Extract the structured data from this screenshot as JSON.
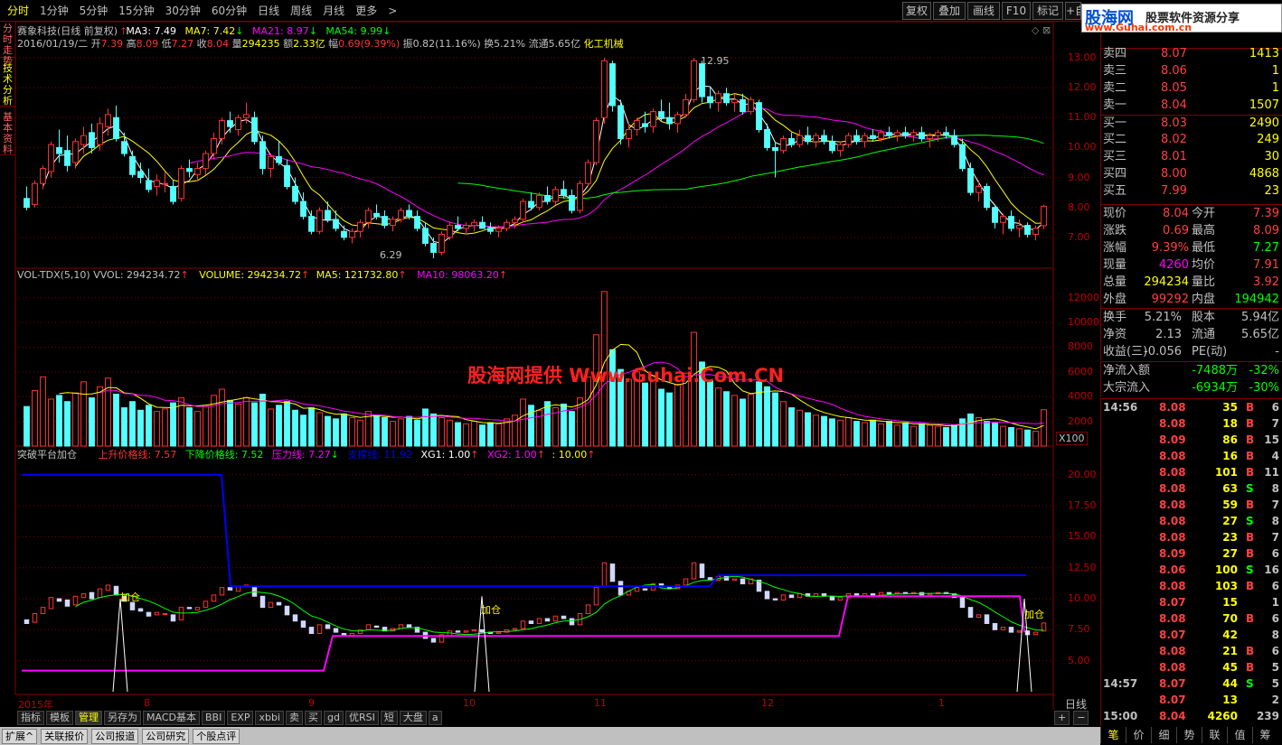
{
  "colors": {
    "up": "#ff3333",
    "down": "#54ffff",
    "ma3": "#ffffff",
    "ma7": "#ffff00",
    "ma21": "#ff00ff",
    "ma54": "#00ff00",
    "pressure": "#0000ff",
    "support": "#ff00ff",
    "accent": "#ffff00",
    "grid": "#800000"
  },
  "toolbar": {
    "periods": [
      "分时",
      "1分钟",
      "5分钟",
      "15分钟",
      "30分钟",
      "60分钟",
      "日线",
      "周线",
      "月线",
      "更多"
    ],
    "active_period": "分时",
    "more_chevron": ">",
    "right_buttons": [
      "复权",
      "叠加",
      "画线",
      "F10",
      "标记",
      "+自"
    ]
  },
  "left_tabs": [
    "分时走势",
    "技术分析",
    "基本资料"
  ],
  "brand": {
    "logo": "股海网",
    "subtitle": "股票软件资源分享",
    "url": "www.Guhai.com.cn"
  },
  "watermark": "股海网提供 Www.Guhai.Com.CN",
  "main_pane": {
    "title": "赛象科技(日线 前复权)",
    "ma3_label": "MA3: 7.49",
    "ma7_label": "MA7: 7.42",
    "ma21_label": "MA21: 8.97",
    "ma54_label": "MA54: 9.99",
    "bar_info": {
      "date": "2016/01/19/二",
      "open_label": "开",
      "open": "7.39",
      "high_label": "高",
      "high": "8.09",
      "low_label": "低",
      "low": "7.27",
      "close_label": "收",
      "close": "8.04",
      "vol_label": "量",
      "vol": "294235",
      "amt_label": "额",
      "amt": "2.33亿",
      "chg_label": "幅",
      "chg": "0.69(9.39%)",
      "amp": "振0.82(11.16%)",
      "turn": "换5.21%",
      "float": "流通5.65亿",
      "sector": "化工机械"
    },
    "high_tag": "12.95",
    "low_tag": "6.29",
    "axis": [
      "13.00",
      "12.00",
      "11.00",
      "10.00",
      "9.00",
      "8.00",
      "7.00"
    ]
  },
  "vol_pane": {
    "title": "VOL-TDX(5,10)",
    "vvol": "VVOL: 294234.72",
    "volume": "VOLUME: 294234.72",
    "ma5": "MA5: 121732.80",
    "ma10": "MA10: 98063.20",
    "axis": [
      "12000",
      "10000",
      "8000",
      "6000",
      "4000",
      "2000"
    ],
    "unit": "X100"
  },
  "ind_pane": {
    "title": "突破平台加仓",
    "up": "上升价格线: 7.57",
    "down": "下降价格线: 7.52",
    "press": "压力线: 7.27",
    "support": "支撑线: 11.92",
    "xg1": "XG1: 1.00",
    "xg2": "XG2: 1.00",
    "ten": ": 10.00",
    "signal": "加仓",
    "axis": [
      "20.00",
      "17.50",
      "15.00",
      "12.50",
      "10.00",
      "7.50",
      "5.00"
    ]
  },
  "x_axis": {
    "labels": [
      "2015年",
      "8",
      "9",
      "10",
      "11",
      "12",
      "1"
    ],
    "period": "日线"
  },
  "bottom_tabs": [
    "指标",
    "模板",
    "管理",
    "另存为",
    "MACD基本",
    "BBI",
    "EXP",
    "xbbi",
    "卖",
    "买",
    "gd",
    "优RSI",
    "短",
    "大盘",
    "a"
  ],
  "bottom_active": "管理",
  "bottom_controls": [
    "+",
    "−",
    "◀",
    "▶"
  ],
  "status_tabs": [
    "扩展^",
    "关联报价",
    "公司报道",
    "公司研究",
    "个股点评"
  ],
  "order_book": {
    "asks": [
      {
        "label": "卖四",
        "price": "8.07",
        "vol": "1413"
      },
      {
        "label": "卖三",
        "price": "8.06",
        "vol": "1"
      },
      {
        "label": "卖二",
        "price": "8.05",
        "vol": "1"
      },
      {
        "label": "卖一",
        "price": "8.04",
        "vol": "1507"
      }
    ],
    "bids": [
      {
        "label": "买一",
        "price": "8.03",
        "vol": "2490"
      },
      {
        "label": "买二",
        "price": "8.02",
        "vol": "249"
      },
      {
        "label": "买三",
        "price": "8.01",
        "vol": "30"
      },
      {
        "label": "买四",
        "price": "8.00",
        "vol": "4868"
      },
      {
        "label": "买五",
        "price": "7.99",
        "vol": "23"
      }
    ]
  },
  "quote": [
    {
      "l1": "现价",
      "v1": "8.04",
      "c1": "#ff4040",
      "l2": "今开",
      "v2": "7.39",
      "c2": "#ff4040"
    },
    {
      "l1": "涨跌",
      "v1": "0.69",
      "c1": "#ff4040",
      "l2": "最高",
      "v2": "8.09",
      "c2": "#ff4040"
    },
    {
      "l1": "涨幅",
      "v1": "9.39%",
      "c1": "#ff4040",
      "l2": "最低",
      "v2": "7.27",
      "c2": "#00ff00"
    },
    {
      "l1": "现量",
      "v1": "4260",
      "c1": "#ff00ff",
      "l2": "均价",
      "v2": "7.91",
      "c2": "#ff4040"
    },
    {
      "l1": "总量",
      "v1": "294234",
      "c1": "#ffff00",
      "l2": "量比",
      "v2": "3.92",
      "c2": "#ff4040"
    },
    {
      "l1": "外盘",
      "v1": "99292",
      "c1": "#ff4040",
      "l2": "内盘",
      "v2": "194942",
      "c2": "#00ff00"
    }
  ],
  "fund": [
    {
      "l1": "换手",
      "v1": "5.21%",
      "l2": "股本",
      "v2": "5.94亿"
    },
    {
      "l1": "净资",
      "v1": "2.13",
      "l2": "流通",
      "v2": "5.65亿"
    },
    {
      "l1": "收益(三)",
      "v1": "-0.056",
      "l2": "PE(动)",
      "v2": "-"
    }
  ],
  "flow": [
    {
      "label": "净流入额",
      "amount": "-7488万",
      "pct": "-32%"
    },
    {
      "label": "大宗流入",
      "amount": "-6934万",
      "pct": "-30%"
    }
  ],
  "ticks": [
    {
      "t": "14:56",
      "p": "8.08",
      "v": "35",
      "s": "B",
      "n": "6"
    },
    {
      "t": "",
      "p": "8.08",
      "v": "18",
      "s": "B",
      "n": "7"
    },
    {
      "t": "",
      "p": "8.09",
      "v": "86",
      "s": "B",
      "n": "15"
    },
    {
      "t": "",
      "p": "8.08",
      "v": "16",
      "s": "B",
      "n": "4"
    },
    {
      "t": "",
      "p": "8.08",
      "v": "101",
      "s": "B",
      "n": "11"
    },
    {
      "t": "",
      "p": "8.08",
      "v": "63",
      "s": "S",
      "n": "8"
    },
    {
      "t": "",
      "p": "8.08",
      "v": "59",
      "s": "B",
      "n": "7"
    },
    {
      "t": "",
      "p": "8.08",
      "v": "27",
      "s": "S",
      "n": "8"
    },
    {
      "t": "",
      "p": "8.08",
      "v": "23",
      "s": "B",
      "n": "7"
    },
    {
      "t": "",
      "p": "8.09",
      "v": "27",
      "s": "B",
      "n": "6"
    },
    {
      "t": "",
      "p": "8.06",
      "v": "100",
      "s": "S",
      "n": "16"
    },
    {
      "t": "",
      "p": "8.08",
      "v": "103",
      "s": "B",
      "n": "6"
    },
    {
      "t": "",
      "p": "8.07",
      "v": "15",
      "s": "",
      "n": "1"
    },
    {
      "t": "",
      "p": "8.08",
      "v": "70",
      "s": "B",
      "n": "6"
    },
    {
      "t": "",
      "p": "8.07",
      "v": "42",
      "s": "",
      "n": "8"
    },
    {
      "t": "",
      "p": "8.08",
      "v": "21",
      "s": "B",
      "n": "6"
    },
    {
      "t": "",
      "p": "8.08",
      "v": "45",
      "s": "B",
      "n": "5"
    },
    {
      "t": "14:57",
      "p": "8.07",
      "v": "44",
      "s": "S",
      "n": "5"
    },
    {
      "t": "",
      "p": "8.07",
      "v": "13",
      "s": "",
      "n": "2"
    },
    {
      "t": "15:00",
      "p": "8.04",
      "v": "4260",
      "s": "",
      "n": "239"
    }
  ],
  "right_bottom_tabs": [
    "笔",
    "价",
    "细",
    "势",
    "联",
    "值",
    "筹"
  ],
  "chart_data": [
    {
      "type": "candlestick",
      "title": "赛象科技(日线 前复权)",
      "ylim": [
        6.0,
        13.3
      ],
      "candles": [
        [
          8.3,
          8.7,
          7.9,
          8.0
        ],
        [
          8.1,
          8.9,
          8.0,
          8.8
        ],
        [
          8.8,
          9.4,
          8.6,
          9.3
        ],
        [
          9.2,
          10.2,
          9.0,
          10.1
        ],
        [
          10.0,
          10.6,
          9.5,
          9.8
        ],
        [
          9.9,
          10.4,
          9.2,
          9.4
        ],
        [
          9.5,
          10.3,
          9.3,
          10.2
        ],
        [
          10.1,
          10.7,
          9.8,
          10.4
        ],
        [
          10.5,
          10.8,
          9.8,
          10.0
        ],
        [
          10.1,
          11.0,
          9.9,
          10.8
        ],
        [
          10.7,
          11.3,
          10.4,
          11.1
        ],
        [
          11.0,
          11.4,
          10.2,
          10.3
        ],
        [
          10.2,
          10.5,
          9.7,
          9.8
        ],
        [
          9.7,
          9.9,
          9.0,
          9.1
        ],
        [
          9.2,
          9.5,
          8.8,
          9.0
        ],
        [
          8.9,
          9.3,
          8.5,
          8.6
        ],
        [
          8.7,
          9.1,
          8.4,
          8.9
        ],
        [
          8.8,
          9.2,
          8.5,
          8.8
        ],
        [
          8.7,
          8.9,
          8.1,
          8.2
        ],
        [
          8.3,
          9.4,
          8.2,
          9.3
        ],
        [
          9.3,
          9.6,
          9.0,
          9.2
        ],
        [
          9.1,
          9.5,
          8.9,
          9.3
        ],
        [
          9.3,
          9.9,
          9.1,
          9.8
        ],
        [
          9.8,
          10.5,
          9.6,
          10.3
        ],
        [
          10.3,
          11.0,
          10.1,
          10.9
        ],
        [
          10.9,
          11.2,
          10.5,
          10.7
        ],
        [
          10.6,
          11.1,
          10.4,
          11.0
        ],
        [
          11.0,
          11.5,
          10.8,
          11.1
        ],
        [
          11.0,
          11.2,
          10.1,
          10.2
        ],
        [
          10.2,
          10.4,
          9.1,
          9.3
        ],
        [
          9.3,
          9.8,
          9.0,
          9.7
        ],
        [
          9.7,
          10.2,
          9.4,
          9.5
        ],
        [
          9.4,
          9.6,
          8.6,
          8.7
        ],
        [
          8.7,
          9.0,
          8.1,
          8.2
        ],
        [
          8.2,
          8.5,
          7.6,
          7.7
        ],
        [
          7.7,
          7.9,
          7.1,
          7.2
        ],
        [
          7.2,
          8.0,
          7.1,
          7.9
        ],
        [
          7.9,
          8.2,
          7.5,
          7.6
        ],
        [
          7.6,
          7.9,
          7.2,
          7.3
        ],
        [
          7.2,
          7.4,
          6.9,
          7.0
        ],
        [
          7.0,
          7.3,
          6.8,
          7.2
        ],
        [
          7.2,
          7.6,
          7.0,
          7.5
        ],
        [
          7.5,
          8.0,
          7.3,
          7.9
        ],
        [
          7.8,
          8.1,
          7.6,
          7.7
        ],
        [
          7.7,
          7.9,
          7.3,
          7.4
        ],
        [
          7.4,
          7.7,
          7.2,
          7.6
        ],
        [
          7.6,
          8.0,
          7.5,
          7.9
        ],
        [
          7.9,
          8.1,
          7.6,
          7.7
        ],
        [
          7.7,
          7.9,
          7.2,
          7.3
        ],
        [
          7.3,
          7.5,
          6.7,
          6.8
        ],
        [
          6.8,
          7.0,
          6.3,
          6.5
        ],
        [
          6.5,
          7.2,
          6.4,
          7.1
        ],
        [
          7.0,
          7.5,
          6.9,
          7.4
        ],
        [
          7.4,
          7.7,
          7.2,
          7.3
        ],
        [
          7.3,
          7.5,
          7.1,
          7.4
        ],
        [
          7.4,
          7.6,
          7.2,
          7.5
        ],
        [
          7.5,
          7.7,
          7.3,
          7.3
        ],
        [
          7.3,
          7.5,
          7.1,
          7.2
        ],
        [
          7.2,
          7.4,
          7.0,
          7.3
        ],
        [
          7.3,
          7.6,
          7.2,
          7.5
        ],
        [
          7.5,
          7.7,
          7.3,
          7.6
        ],
        [
          7.6,
          8.3,
          7.5,
          8.2
        ],
        [
          8.2,
          8.5,
          7.9,
          8.0
        ],
        [
          8.0,
          8.5,
          7.9,
          8.4
        ],
        [
          8.4,
          8.7,
          8.1,
          8.2
        ],
        [
          8.2,
          8.7,
          8.1,
          8.6
        ],
        [
          8.6,
          8.9,
          8.3,
          8.4
        ],
        [
          8.4,
          8.6,
          7.8,
          7.9
        ],
        [
          7.9,
          8.9,
          7.8,
          8.8
        ],
        [
          8.8,
          9.6,
          8.7,
          9.5
        ],
        [
          9.5,
          11.0,
          9.4,
          10.9
        ],
        [
          11.0,
          13.0,
          10.8,
          12.9
        ],
        [
          12.8,
          12.9,
          11.2,
          11.4
        ],
        [
          11.4,
          11.6,
          10.1,
          10.3
        ],
        [
          10.3,
          10.8,
          10.0,
          10.6
        ],
        [
          10.6,
          11.0,
          10.4,
          10.9
        ],
        [
          10.8,
          11.2,
          10.5,
          10.7
        ],
        [
          10.7,
          11.3,
          10.5,
          11.2
        ],
        [
          11.2,
          11.6,
          10.9,
          11.0
        ],
        [
          11.0,
          11.5,
          10.6,
          10.8
        ],
        [
          10.8,
          11.2,
          10.5,
          11.1
        ],
        [
          11.1,
          11.8,
          11.0,
          11.6
        ],
        [
          11.6,
          13.0,
          11.5,
          12.9
        ],
        [
          12.8,
          12.9,
          11.5,
          11.7
        ],
        [
          11.7,
          12.0,
          11.3,
          11.5
        ],
        [
          11.5,
          11.9,
          11.2,
          11.8
        ],
        [
          11.8,
          12.0,
          11.4,
          11.5
        ],
        [
          11.5,
          11.8,
          11.2,
          11.6
        ],
        [
          11.6,
          11.8,
          11.1,
          11.2
        ],
        [
          11.2,
          11.7,
          11.1,
          11.6
        ],
        [
          11.5,
          11.6,
          10.5,
          10.6
        ],
        [
          10.6,
          10.8,
          9.9,
          10.0
        ],
        [
          10.0,
          10.2,
          9.0,
          9.9
        ],
        [
          9.9,
          10.4,
          9.8,
          10.3
        ],
        [
          10.3,
          10.5,
          10.0,
          10.1
        ],
        [
          10.1,
          10.6,
          10.0,
          10.4
        ],
        [
          10.4,
          10.7,
          10.1,
          10.2
        ],
        [
          10.2,
          10.5,
          10.0,
          10.4
        ],
        [
          10.4,
          10.6,
          10.1,
          10.2
        ],
        [
          10.2,
          10.4,
          9.8,
          9.9
        ],
        [
          9.9,
          10.2,
          9.7,
          10.1
        ],
        [
          10.1,
          10.5,
          10.0,
          10.4
        ],
        [
          10.4,
          10.6,
          10.1,
          10.2
        ],
        [
          10.2,
          10.5,
          10.0,
          10.4
        ],
        [
          10.4,
          10.6,
          10.2,
          10.3
        ],
        [
          10.3,
          10.6,
          10.2,
          10.5
        ],
        [
          10.5,
          10.7,
          10.3,
          10.4
        ],
        [
          10.4,
          10.6,
          10.2,
          10.5
        ],
        [
          10.5,
          10.7,
          10.3,
          10.4
        ],
        [
          10.4,
          10.6,
          10.2,
          10.5
        ],
        [
          10.5,
          10.7,
          10.2,
          10.3
        ],
        [
          10.3,
          10.5,
          10.0,
          10.4
        ],
        [
          10.4,
          10.6,
          10.2,
          10.5
        ],
        [
          10.5,
          10.7,
          10.3,
          10.4
        ],
        [
          10.4,
          10.6,
          10.0,
          10.1
        ],
        [
          10.1,
          10.3,
          9.2,
          9.3
        ],
        [
          9.3,
          9.5,
          8.4,
          8.5
        ],
        [
          8.5,
          8.9,
          8.2,
          8.7
        ],
        [
          8.7,
          8.8,
          7.9,
          8.0
        ],
        [
          8.0,
          8.1,
          7.3,
          7.5
        ],
        [
          7.5,
          7.8,
          7.1,
          7.7
        ],
        [
          7.7,
          7.9,
          7.2,
          7.3
        ],
        [
          7.3,
          7.6,
          7.0,
          7.4
        ],
        [
          7.4,
          7.5,
          7.0,
          7.1
        ],
        [
          7.1,
          7.4,
          6.9,
          7.3
        ],
        [
          7.39,
          8.09,
          7.27,
          8.04
        ]
      ]
    },
    {
      "type": "bar",
      "title": "VOL-TDX(5,10)",
      "ylim": [
        0,
        13000
      ],
      "values": [
        3200,
        4500,
        5600,
        3800,
        4100,
        3600,
        4300,
        5200,
        3900,
        4800,
        5500,
        4200,
        3100,
        3600,
        2900,
        3300,
        2800,
        3000,
        3500,
        3900,
        3100,
        2800,
        3200,
        4100,
        4600,
        3700,
        3400,
        3900,
        3500,
        4200,
        3000,
        3300,
        3600,
        2900,
        2500,
        3100,
        2700,
        2400,
        2200,
        2600,
        2300,
        2100,
        2800,
        2500,
        2300,
        2000,
        2200,
        2400,
        2100,
        3000,
        2600,
        2300,
        2100,
        1900,
        1800,
        2000,
        1700,
        1900,
        1800,
        2200,
        2500,
        3800,
        3300,
        2900,
        3600,
        3100,
        3400,
        2800,
        3900,
        5600,
        9000,
        12500,
        7800,
        6200,
        5400,
        6000,
        5100,
        5700,
        4600,
        4300,
        5000,
        5900,
        9200,
        6800,
        5300,
        4700,
        4400,
        4100,
        3800,
        4200,
        5200,
        4800,
        4300,
        3600,
        3100,
        2900,
        2700,
        2500,
        2400,
        2200,
        2100,
        2300,
        2000,
        1900,
        2100,
        1800,
        2000,
        1700,
        1900,
        1600,
        1800,
        1700,
        1600,
        1500,
        1700,
        2200,
        2600,
        2300,
        2000,
        1900,
        1600,
        1500,
        1400,
        1300,
        1200,
        2942
      ]
    }
  ]
}
